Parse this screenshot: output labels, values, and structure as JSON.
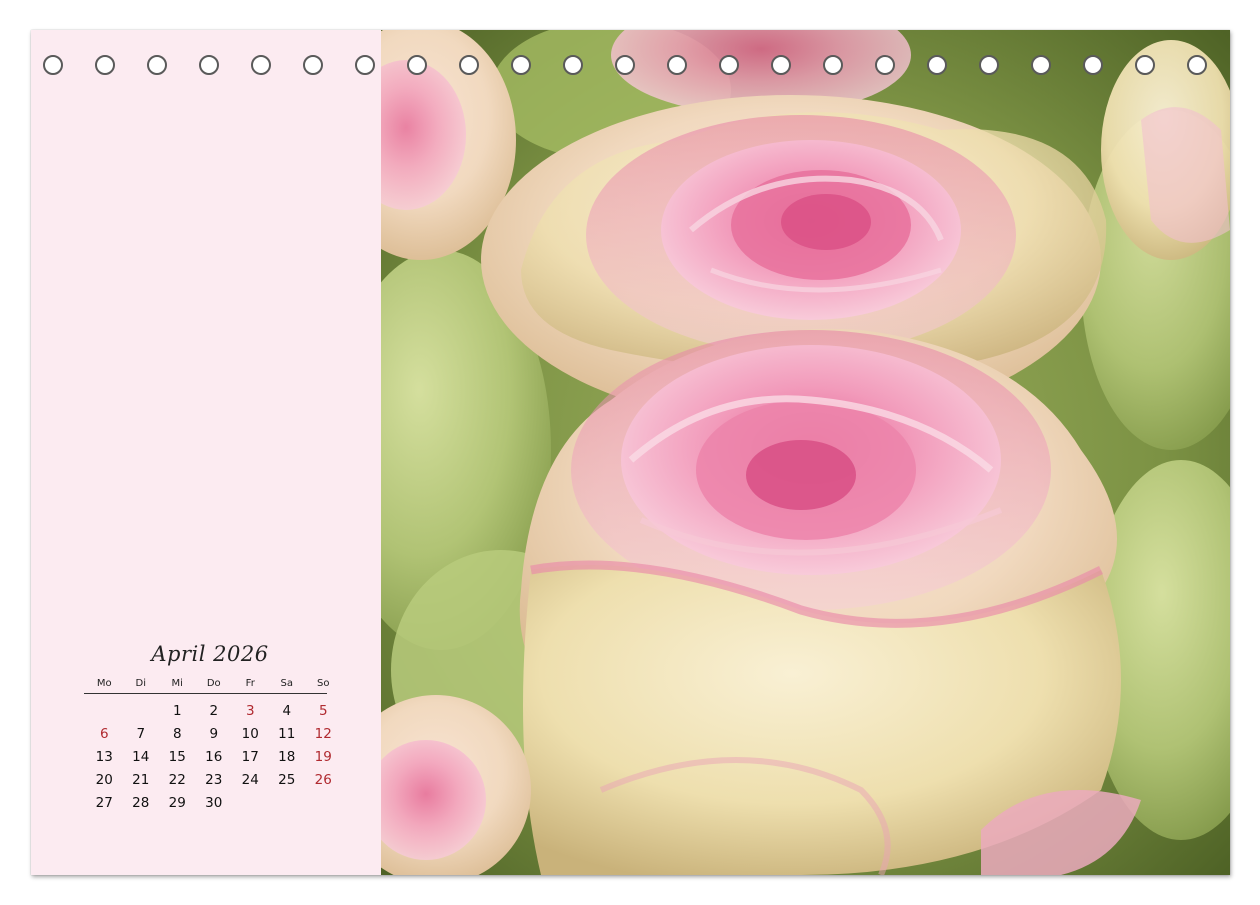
{
  "calendar": {
    "month_title": "April 2026",
    "weekday_headers": [
      "Mo",
      "Di",
      "Mi",
      "Do",
      "Fr",
      "Sa",
      "So"
    ],
    "weeks": [
      [
        "",
        "",
        "1",
        "2",
        "3",
        "4",
        "5"
      ],
      [
        "6",
        "7",
        "8",
        "9",
        "10",
        "11",
        "12"
      ],
      [
        "13",
        "14",
        "15",
        "16",
        "17",
        "18",
        "19"
      ],
      [
        "20",
        "21",
        "22",
        "23",
        "24",
        "25",
        "26"
      ],
      [
        "27",
        "28",
        "29",
        "30",
        "",
        "",
        ""
      ]
    ],
    "highlighted_days": [
      "3",
      "5",
      "6",
      "12",
      "19",
      "26"
    ]
  },
  "photo": {
    "subject": "pink-cream-roses",
    "icon": "roses-photo"
  },
  "binding": {
    "hole_count": 23
  },
  "colors": {
    "side_panel_bg": "#fcebf1",
    "holiday_red": "#b02a30",
    "rose_pink": "#e87aa0",
    "rose_cream": "#f3e6c4",
    "leaf_green": "#a9be6e"
  }
}
